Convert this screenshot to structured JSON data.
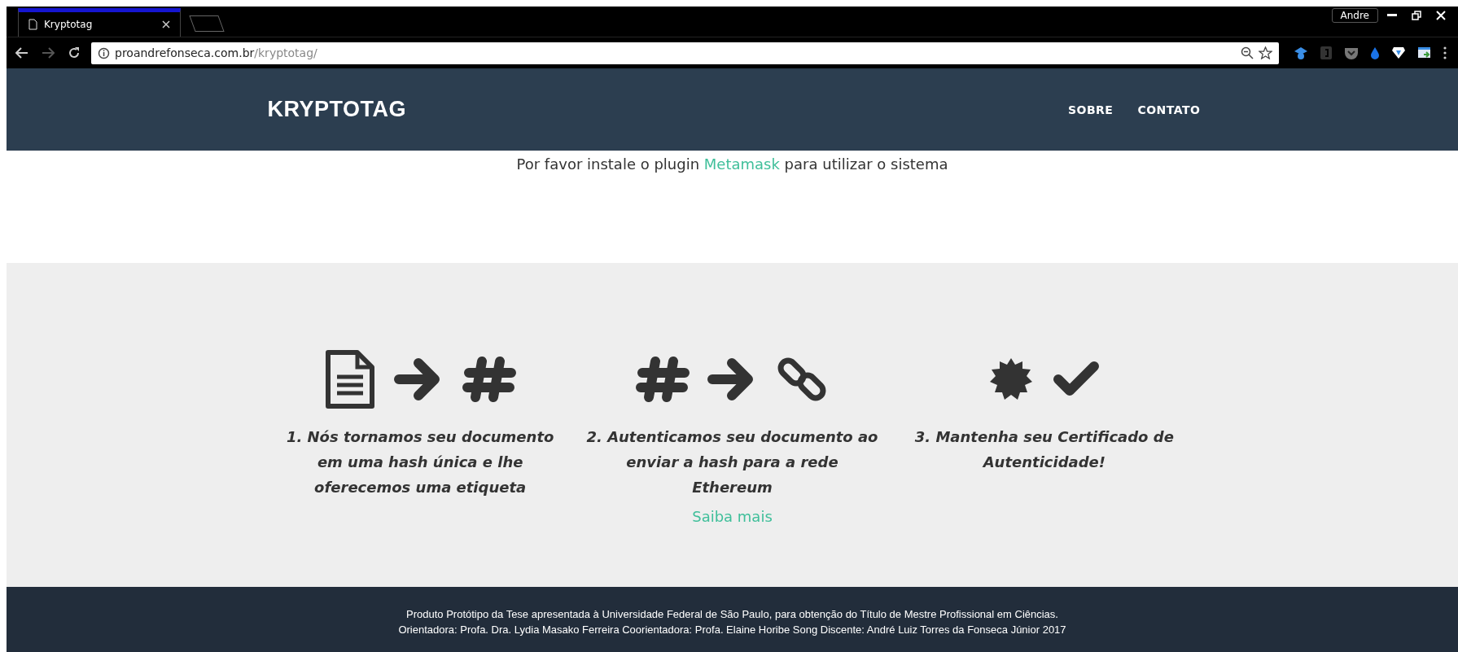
{
  "browser": {
    "tab": {
      "title": "Kryptotag",
      "selected": true
    },
    "profile": "Andre",
    "url": {
      "host": "proandrefonseca.com.br",
      "path": "/kryptotag/"
    }
  },
  "nav": {
    "brand": "KRYPTOTAG",
    "links": [
      "SOBRE",
      "CONTATO"
    ]
  },
  "notice": {
    "before": "Por favor instale o plugin ",
    "link": "Metamask",
    "after": " para utilizar o sistema"
  },
  "steps": [
    {
      "text": "1. Nós tornamos seu documento em uma hash única e lhe oferecemos uma etiqueta"
    },
    {
      "text": "2. Autenticamos seu documento ao enviar a hash para a rede Ethereum",
      "link": "Saiba mais"
    },
    {
      "text": "3. Mantenha seu Certificado de Autenticidade!"
    }
  ],
  "footer": [
    "Produto Protótipo da Tese apresentada à Universidade Federal de São Paulo, para obtenção do Título de Mestre Profissional em Ciências.",
    "Orientadora: Profa. Dra. Lydia Masako Ferreira Coorientadora: Profa. Elaine Horibe Song Discente: André Luiz Torres da Fonseca Júnior 2017"
  ]
}
